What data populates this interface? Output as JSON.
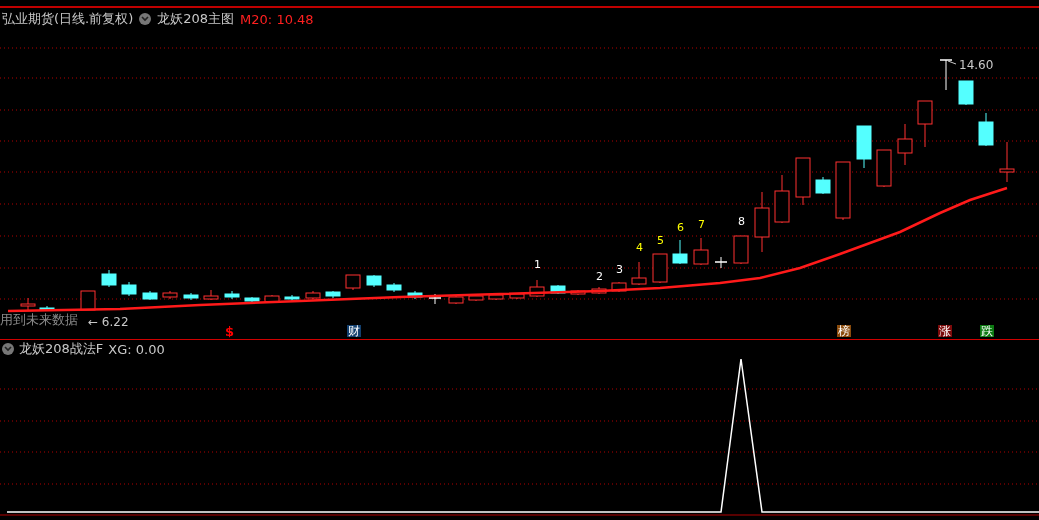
{
  "header": {
    "title": "弘业期货(日线.前复权)",
    "indicator": "龙妖208主图",
    "ma_reading": "M20: 10.48"
  },
  "main_chart": {
    "high_label": "14.60",
    "low_label": "← 6.22",
    "warning": "用到未来数据",
    "signal_labels": [
      {
        "text": "1",
        "color": "#ffffff"
      },
      {
        "text": "2",
        "color": "#ffffff"
      },
      {
        "text": "3",
        "color": "#ffffff"
      },
      {
        "text": "4",
        "color": "#ffff00"
      },
      {
        "text": "5",
        "color": "#ffff00"
      },
      {
        "text": "6",
        "color": "#ffff00"
      },
      {
        "text": "7",
        "color": "#ffff00"
      },
      {
        "text": "8",
        "color": "#ffffff"
      }
    ],
    "event_markers": [
      {
        "text": "$",
        "kind": "symbol",
        "color": "#ff0000"
      },
      {
        "text": "财",
        "kind": "tag",
        "color": "#123f6e"
      },
      {
        "text": "榜",
        "kind": "tag",
        "color": "#8a4b0c"
      },
      {
        "text": "涨",
        "kind": "tag",
        "color": "#7c0a0a"
      },
      {
        "text": "跌",
        "kind": "tag",
        "color": "#0d7a12"
      }
    ]
  },
  "sub_panel": {
    "title": "龙妖208战法F",
    "reading": "XG: 0.00"
  }
}
